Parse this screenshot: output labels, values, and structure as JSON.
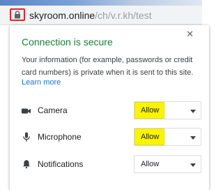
{
  "address_bar": {
    "host": "skyroom.online",
    "path": "/ch/v.r.kh/test",
    "lock_icon": "lock-icon"
  },
  "site_info": {
    "title": "Connection is secure",
    "description": "Your information (for example, passwords or credit card numbers) is private when it is sent to this site.",
    "learn_more": "Learn more",
    "close_icon": "close-icon"
  },
  "permissions": [
    {
      "label": "Camera",
      "icon": "camera-icon",
      "value": "Allow",
      "highlighted": true
    },
    {
      "label": "Microphone",
      "icon": "microphone-icon",
      "value": "Allow",
      "highlighted": true
    },
    {
      "label": "Notifications",
      "icon": "bell-icon",
      "value": "Allow",
      "highlighted": false
    }
  ],
  "colors": {
    "secure_green": "#188038",
    "link_blue": "#1a73e8",
    "highlight_yellow": "#fbf400",
    "annotation_red": "#e0262d"
  }
}
